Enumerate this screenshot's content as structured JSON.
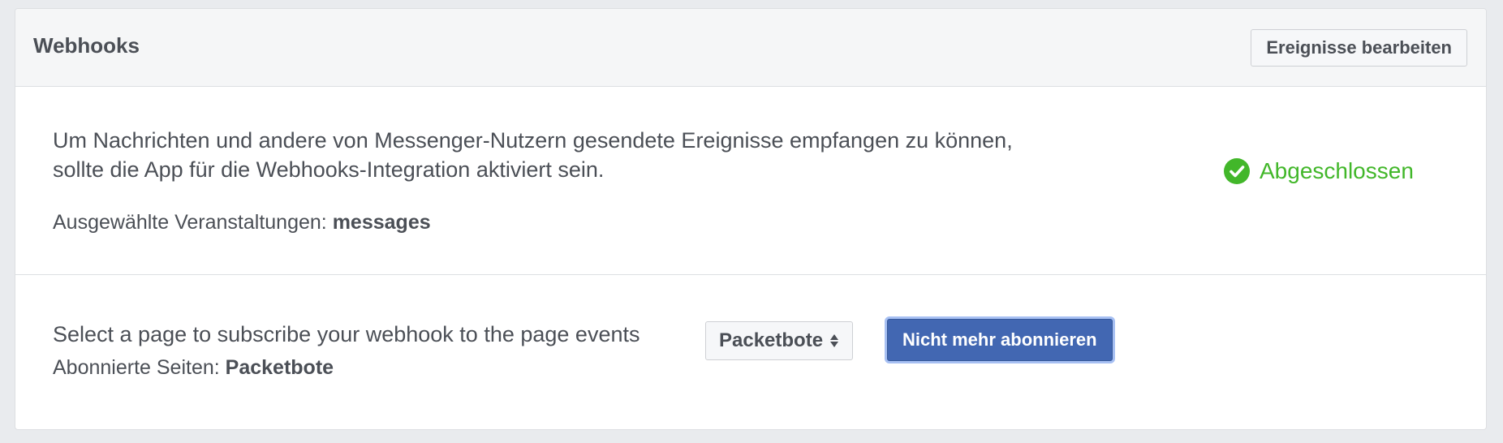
{
  "header": {
    "title": "Webhooks",
    "edit_events_label": "Ereignisse bearbeiten"
  },
  "webhooks": {
    "description": "Um Nachrichten und andere von Messenger-Nutzern gesendete Ereignisse empfangen zu können, sollte die App für die Webhooks-Integration aktiviert sein.",
    "selected_events_label": "Ausgewählte Veranstaltungen:",
    "selected_events_value": "messages",
    "status_label": "Abgeschlossen",
    "status_icon": "check-circle-icon",
    "status_color": "#42b72a"
  },
  "subscription": {
    "instruction": "Select a page to subscribe your webhook to the page events",
    "subscribed_pages_label": "Abonnierte Seiten:",
    "subscribed_pages_value": "Packetbote",
    "page_select_value": "Packetbote",
    "unsubscribe_label": "Nicht mehr abonnieren",
    "accent_color": "#4267b2"
  }
}
